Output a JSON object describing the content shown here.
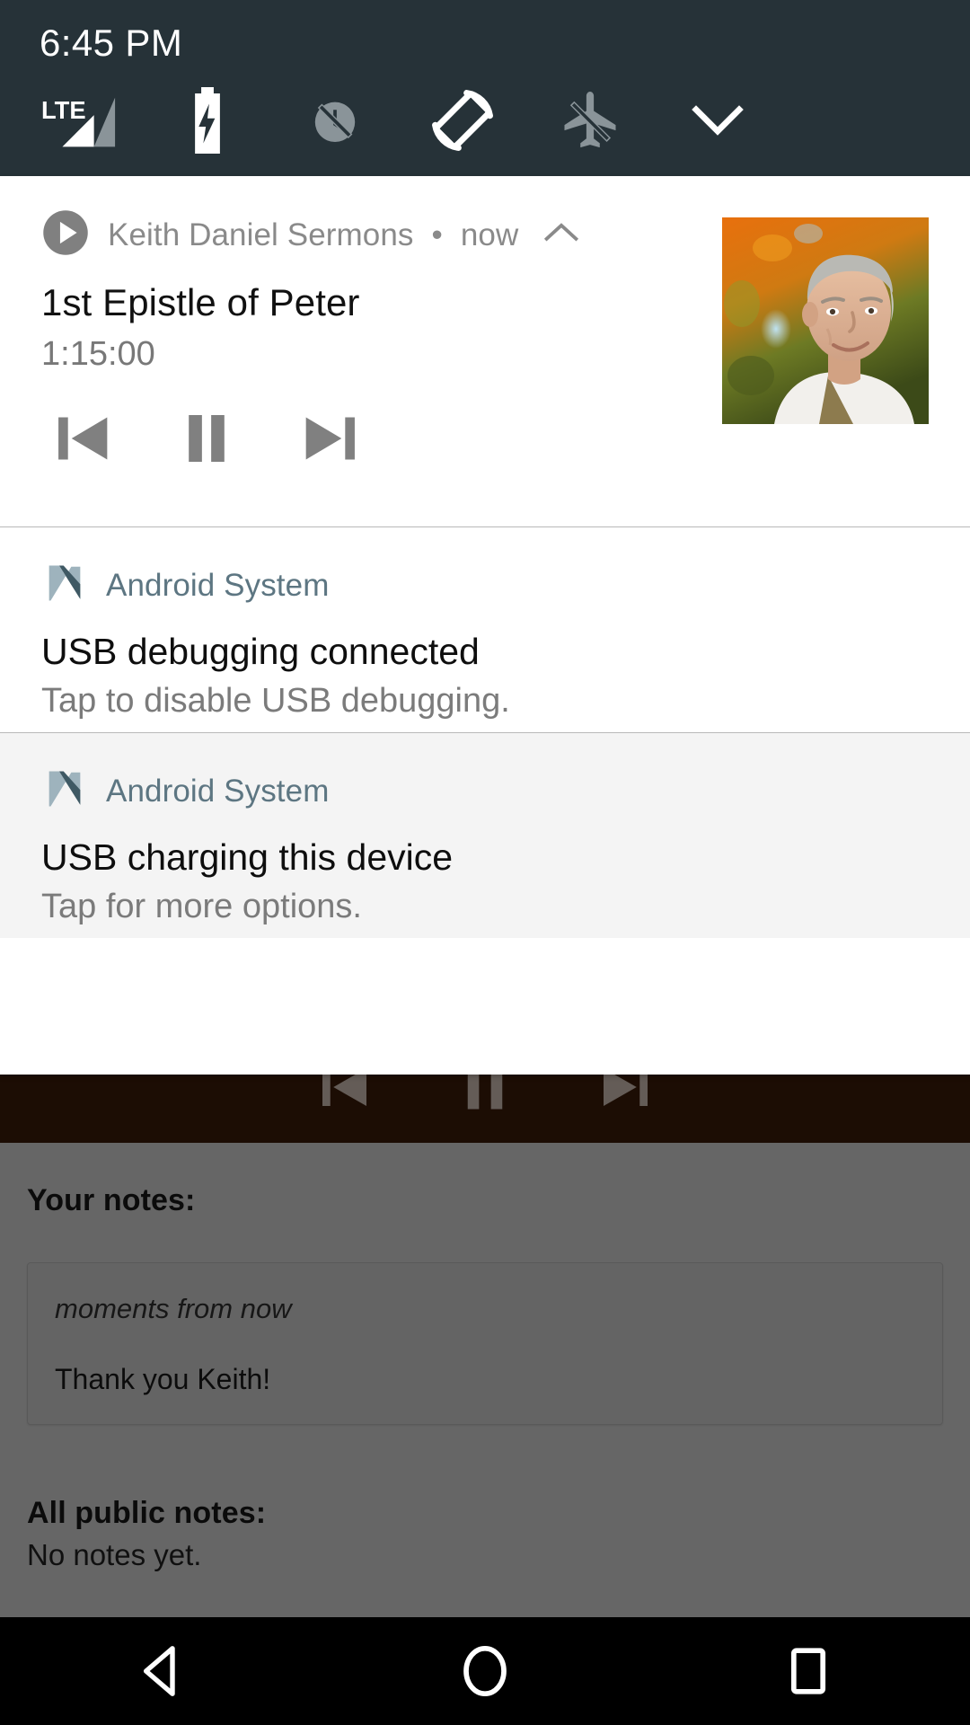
{
  "status_bar": {
    "clock": "6:45 PM",
    "background_color": "#263238",
    "icons": [
      {
        "name": "lte-signal-icon",
        "label": "LTE",
        "active": true
      },
      {
        "name": "battery-charging-icon",
        "label": "Battery charging",
        "active": true
      },
      {
        "name": "alarm-off-icon",
        "label": "Alarm off",
        "active": false
      },
      {
        "name": "auto-rotate-icon",
        "label": "Auto rotate",
        "active": true
      },
      {
        "name": "airplane-mode-off-icon",
        "label": "Airplane mode off",
        "active": false
      },
      {
        "name": "chevron-down-icon",
        "label": "Expand quick settings",
        "active": true
      }
    ]
  },
  "notifications": [
    {
      "kind": "media",
      "app_name": "Keith Daniel Sermons",
      "separator": "•",
      "time": "now",
      "collapse_icon": "chevron-up-icon",
      "title": "1st Epistle of Peter",
      "duration": "1:15:00",
      "controls": [
        {
          "name": "previous-track-button",
          "label": "Previous"
        },
        {
          "name": "pause-button",
          "label": "Pause"
        },
        {
          "name": "next-track-button",
          "label": "Next"
        }
      ],
      "album_art_name": "album-art-thumbnail"
    },
    {
      "kind": "system",
      "app_name": "Android System",
      "title": "USB debugging connected",
      "body": "Tap to disable USB debugging.",
      "tinted": false
    },
    {
      "kind": "system",
      "app_name": "Android System",
      "title": "USB charging this device",
      "body": "Tap for more options.",
      "tinted": true
    }
  ],
  "app_behind": {
    "dark_band_color": "#1c0d04",
    "mini_controls": [
      {
        "name": "previous-track-button-mini",
        "label": "Previous"
      },
      {
        "name": "pause-button-mini",
        "label": "Pause"
      },
      {
        "name": "next-track-button-mini",
        "label": "Next"
      }
    ],
    "your_notes_heading": "Your notes:",
    "note": {
      "timestamp": "moments from now",
      "text": "Thank you Keith!"
    },
    "public_notes_heading": "All public notes:",
    "public_notes_empty": "No notes yet."
  },
  "nav_bar": {
    "background_color": "#000000",
    "buttons": [
      {
        "name": "nav-back-button",
        "label": "Back"
      },
      {
        "name": "nav-home-button",
        "label": "Home"
      },
      {
        "name": "nav-recents-button",
        "label": "Recents"
      }
    ]
  },
  "colors": {
    "status_bar": "#263238",
    "shade_bg": "#ffffff",
    "shade_tint": "#f4f4f4",
    "system_app_name": "#5d7682",
    "media_app_name": "#8a8a8a",
    "dark_band": "#1c0d04"
  }
}
